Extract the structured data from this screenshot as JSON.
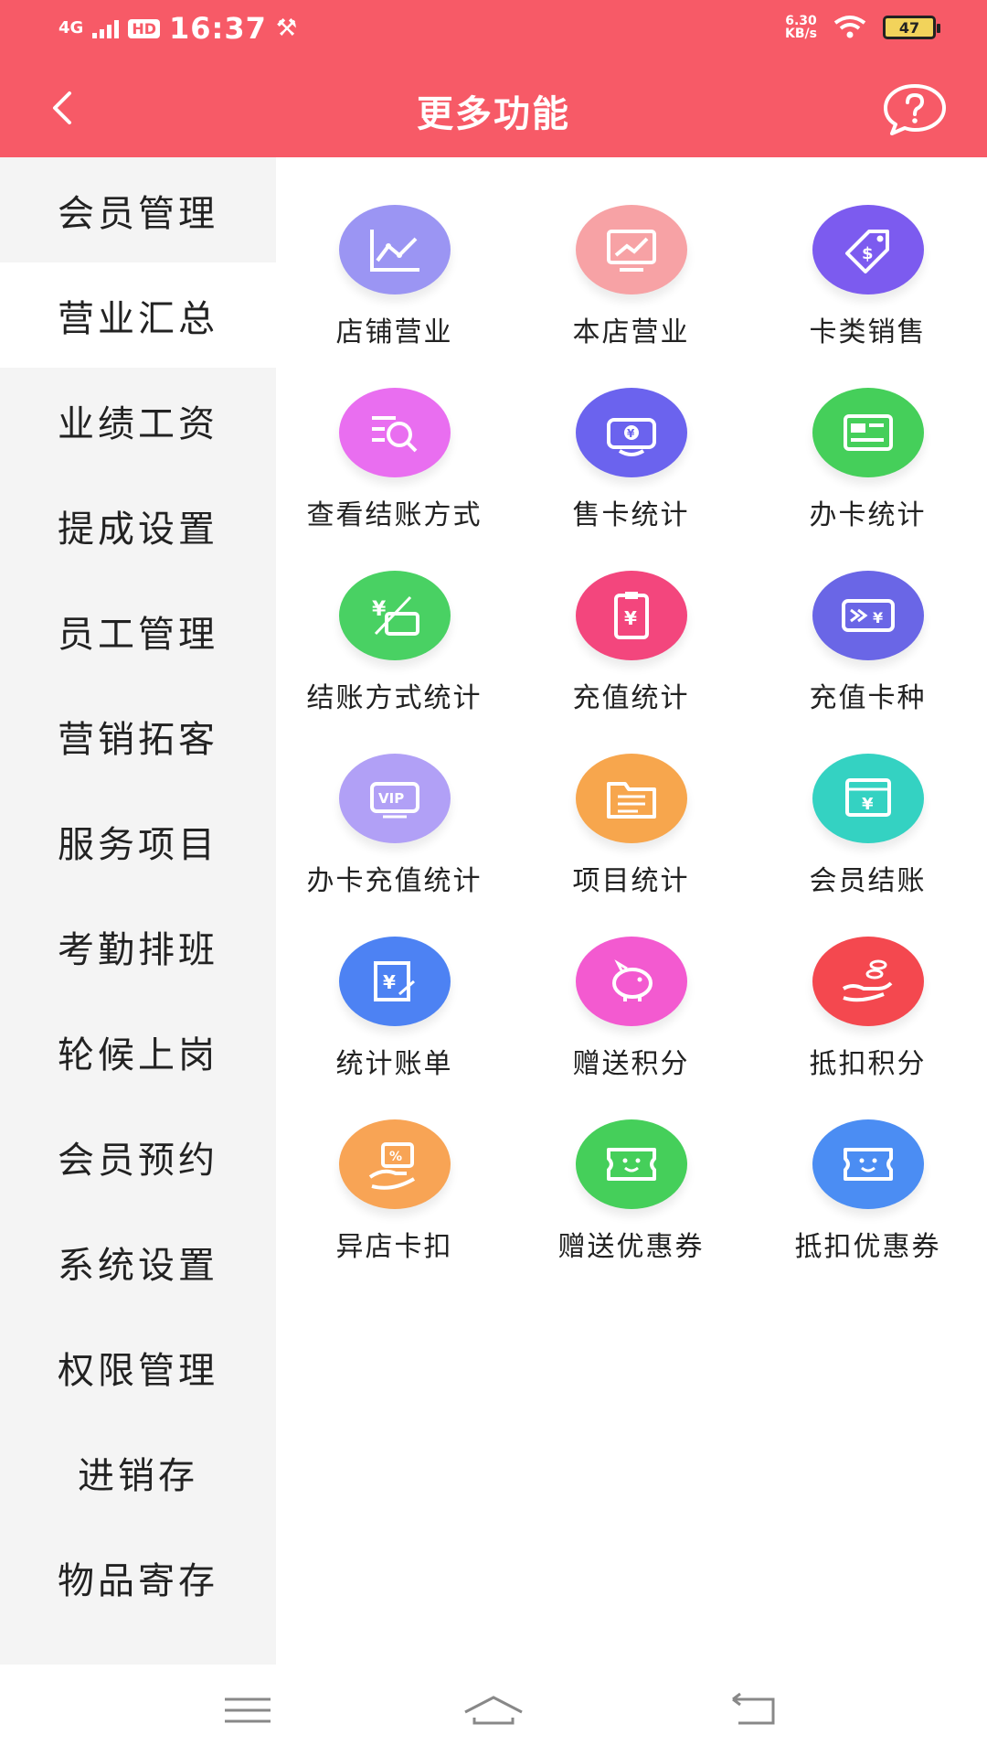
{
  "status": {
    "network": "4G",
    "hd": "HD",
    "time": "16:37",
    "speed_value": "6.30",
    "speed_unit": "KB/s",
    "battery": "47"
  },
  "header": {
    "title": "更多功能"
  },
  "sidebar": {
    "items": [
      "会员管理",
      "营业汇总",
      "业绩工资",
      "提成设置",
      "员工管理",
      "营销拓客",
      "服务项目",
      "考勤排班",
      "轮候上岗",
      "会员预约",
      "系统设置",
      "权限管理",
      "进销存",
      "物品寄存"
    ]
  },
  "grid": {
    "items": [
      {
        "label": "店铺营业",
        "icon": "line-chart-icon",
        "color": "#9b95f3"
      },
      {
        "label": "本店营业",
        "icon": "trend-board-icon",
        "color": "#f7a2a5"
      },
      {
        "label": "卡类销售",
        "icon": "price-tag-icon",
        "color": "#7c5bef"
      },
      {
        "label": "查看结账方式",
        "icon": "search-list-icon",
        "color": "#e96ef0"
      },
      {
        "label": "售卡统计",
        "icon": "wallet-yen-icon",
        "color": "#6b63ee"
      },
      {
        "label": "办卡统计",
        "icon": "id-card-icon",
        "color": "#45cf5a"
      },
      {
        "label": "结账方式统计",
        "icon": "yen-card-icon",
        "color": "#49d163"
      },
      {
        "label": "充值统计",
        "icon": "clipboard-yen-icon",
        "color": "#f3467d"
      },
      {
        "label": "充值卡种",
        "icon": "arrow-card-icon",
        "color": "#6a66e6"
      },
      {
        "label": "办卡充值统计",
        "icon": "vip-card-icon",
        "color": "#b1a0f6"
      },
      {
        "label": "项目统计",
        "icon": "folder-list-icon",
        "color": "#f7a64d"
      },
      {
        "label": "会员结账",
        "icon": "yen-screen-icon",
        "color": "#34d2c2"
      },
      {
        "label": "统计账单",
        "icon": "yen-bill-icon",
        "color": "#4d82f3"
      },
      {
        "label": "赠送积分",
        "icon": "piggy-bank-icon",
        "color": "#f35ad0"
      },
      {
        "label": "抵扣积分",
        "icon": "coin-hand-icon",
        "color": "#f4484f"
      },
      {
        "label": "异店卡扣",
        "icon": "discount-card-icon",
        "color": "#f8a455"
      },
      {
        "label": "赠送优惠券",
        "icon": "coupon-smile-icon",
        "color": "#45cf5a"
      },
      {
        "label": "抵扣优惠券",
        "icon": "coupon-smile-icon",
        "color": "#4b8df3"
      }
    ]
  },
  "colors": {
    "header": "#f75a67",
    "sidebar_bg": "#f4f4f4",
    "active_bg": "#ffffff"
  }
}
